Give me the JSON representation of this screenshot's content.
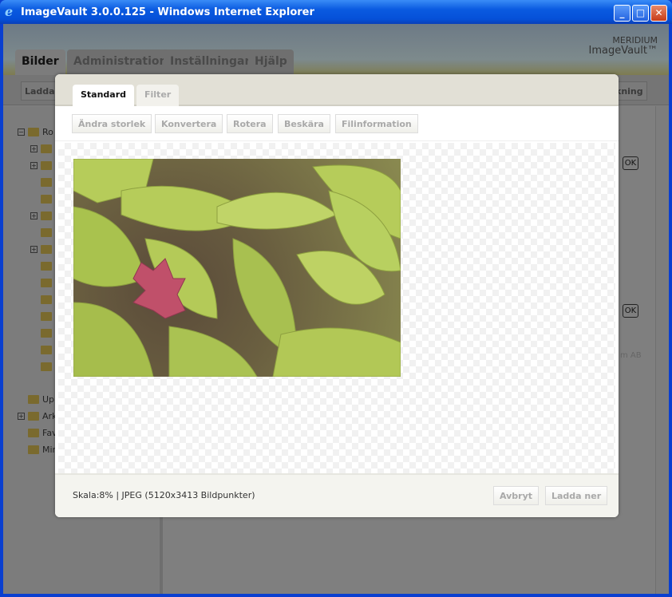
{
  "window": {
    "title": "ImageVault 3.0.0.125 - Windows Internet Explorer",
    "controls": [
      "minimize",
      "maximize",
      "close"
    ]
  },
  "header": {
    "tabs": [
      {
        "label": "Bilder",
        "active": true
      },
      {
        "label": "Administration"
      },
      {
        "label": "Inställningar"
      },
      {
        "label": "Hjälp"
      }
    ],
    "logo_top": "MERIDIUM",
    "logo_bottom": "ImageVault™"
  },
  "toolbar": {
    "left_button": "Ladda",
    "right_button": "kning"
  },
  "tree": {
    "root": "Ro",
    "items": [
      {
        "plus": true
      },
      {
        "plus": true
      },
      {},
      {},
      {
        "plus": true
      },
      {},
      {
        "plus": true
      },
      {},
      {},
      {},
      {},
      {},
      {},
      {}
    ],
    "special": [
      {
        "label": "Upp"
      },
      {
        "label": "Ark",
        "plus": true
      },
      {
        "label": "Fav"
      },
      {
        "label": "Min"
      }
    ]
  },
  "main": {
    "ok1": "OK",
    "ok2": "OK",
    "footer_text": "m AB"
  },
  "modal": {
    "tabs": [
      {
        "label": "Standard",
        "active": true
      },
      {
        "label": "Filter"
      }
    ],
    "tools": [
      "Ändra storlek",
      "Konvertera",
      "Rotera",
      "Beskära",
      "Filinformation"
    ],
    "status": "Skala:8% | JPEG (5120x3413 Bildpunkter)",
    "cancel": "Avbryt",
    "download": "Ladda ner"
  }
}
